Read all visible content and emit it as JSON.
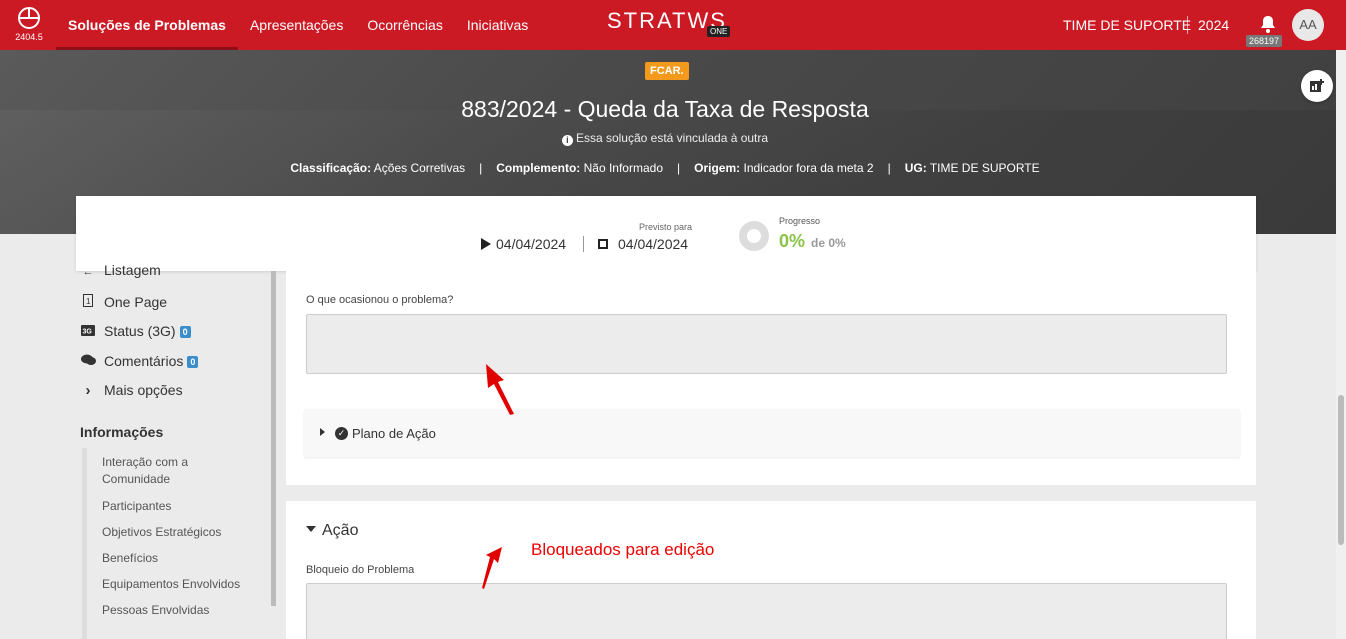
{
  "topbar": {
    "version": "2404.5",
    "nav": [
      "Soluções de Problemas",
      "Apresentações",
      "Ocorrências",
      "Iniciativas"
    ],
    "brand": "STRATWS",
    "brand_tag": "ONE",
    "team": "TIME DE SUPORTE",
    "year": "2024",
    "notification_count": "268197",
    "avatar_initials": "AA",
    "accent_color": "#cc1a25"
  },
  "hero": {
    "tag": "FCAR.",
    "title": "883/2024 - Queda da Taxa de Resposta",
    "linked_note": "Essa solução está vinculada à outra",
    "classificacao_label": "Classificação:",
    "classificacao_value": "Ações Corretivas",
    "complemento_label": "Complemento:",
    "complemento_value": "Não Informado",
    "origem_label": "Origem:",
    "origem_value": "Indicador fora da meta 2",
    "ug_label": "UG:",
    "ug_value": "TIME DE SUPORTE"
  },
  "dates": {
    "start": "04/04/2024",
    "prev_label": "Previsto para",
    "end": "04/04/2024",
    "progress_label": "Progresso",
    "progress_value": "0%",
    "progress_of": "de 0%"
  },
  "sidebar": {
    "items": [
      {
        "label": "Listagem",
        "icon": "arrow-left-icon"
      },
      {
        "label": "One Page",
        "icon": "page-icon"
      },
      {
        "label": "Status (3G)",
        "icon": "3g-icon",
        "badge": "0"
      },
      {
        "label": "Comentários",
        "icon": "comments-icon",
        "badge": "0"
      },
      {
        "label": "Mais opções",
        "icon": "chevron-right-icon"
      }
    ],
    "info_title": "Informações",
    "info_links": [
      "Interação com a Comunidade",
      "Participantes",
      "Objetivos Estratégicos",
      "Benefícios",
      "Equipamentos Envolvidos",
      "Pessoas Envolvidas"
    ]
  },
  "main": {
    "cause_label": "O que ocasionou o problema?",
    "plano_label": "Plano de Ação",
    "acao_title": "Ação",
    "bloqueio_label": "Bloqueio do Problema",
    "annotation": "Bloqueados para edição",
    "annotation_color": "#e00000"
  }
}
